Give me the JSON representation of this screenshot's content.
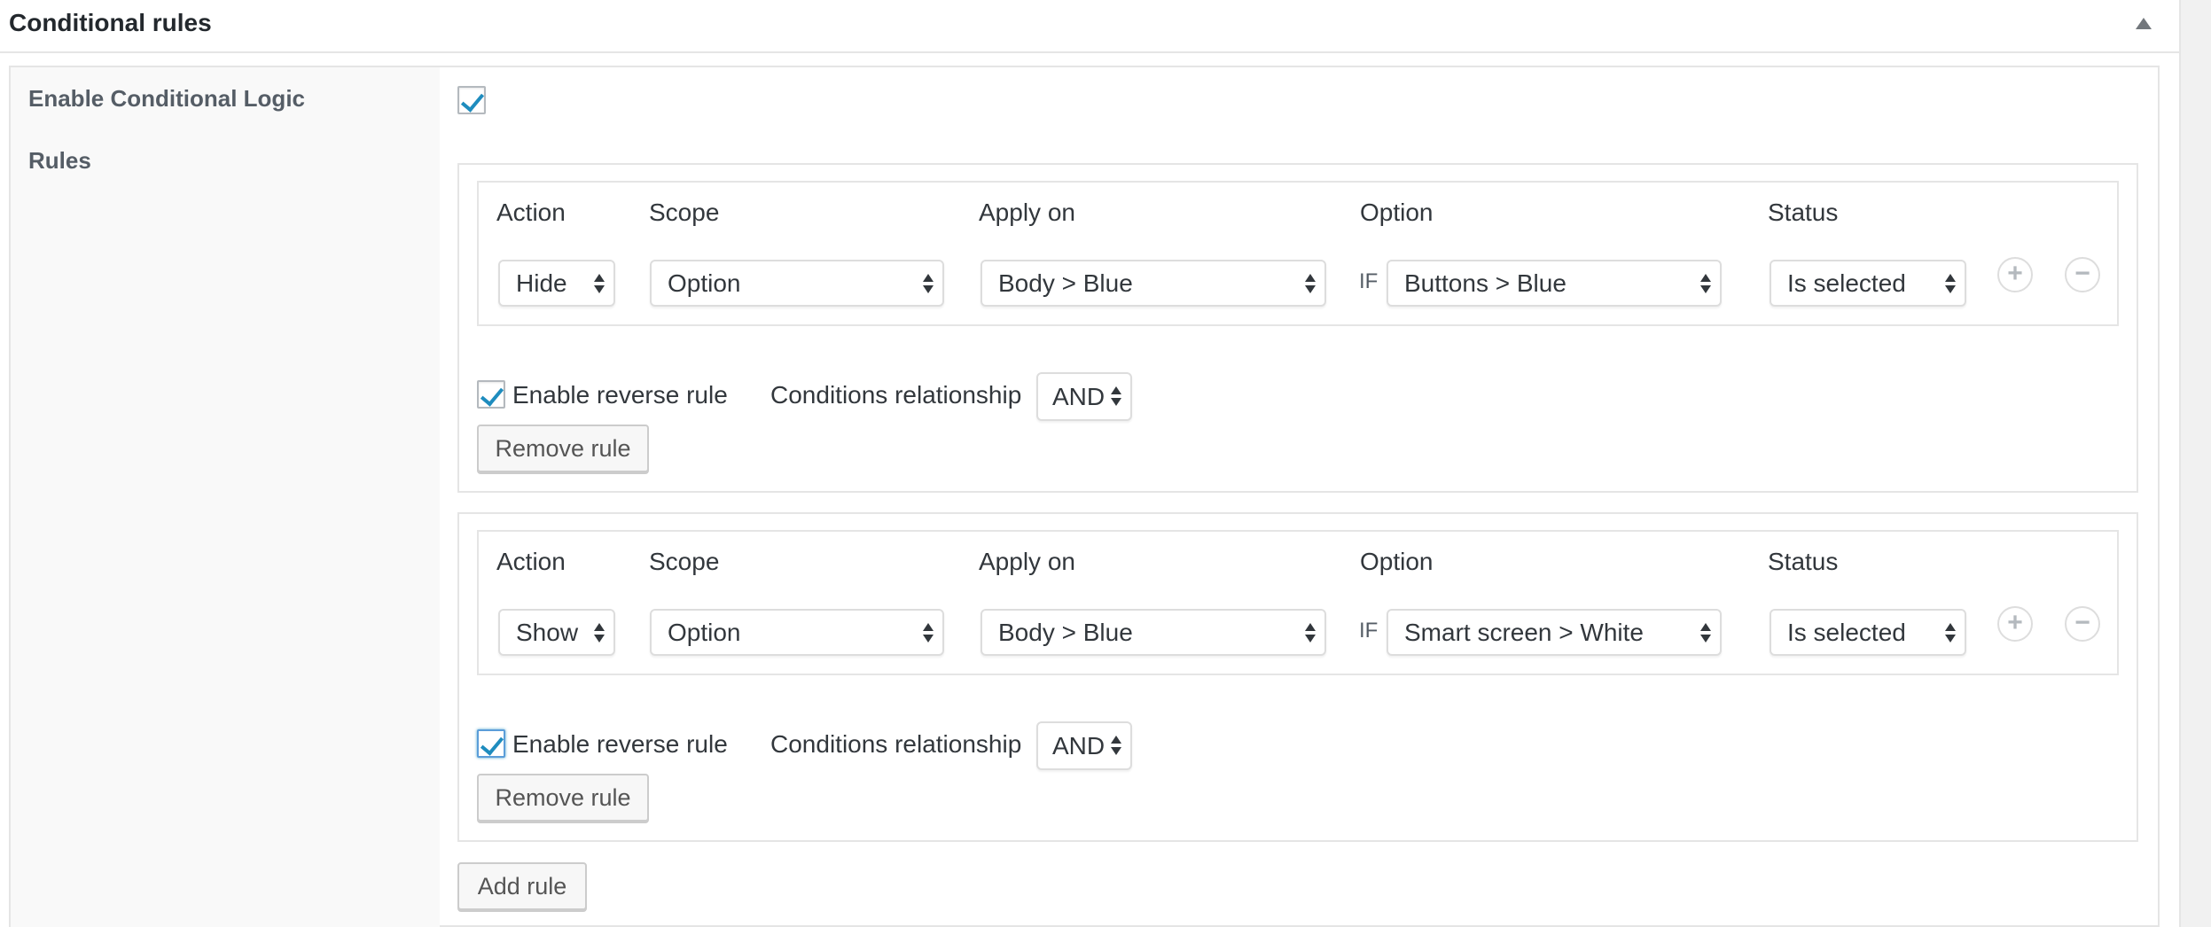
{
  "metabox": {
    "title": "Conditional rules"
  },
  "fields": {
    "enable_label": "Enable Conditional Logic",
    "enable_checked": true,
    "rules_label": "Rules"
  },
  "columns": {
    "action": "Action",
    "scope": "Scope",
    "apply_on": "Apply on",
    "option": "Option",
    "status": "Status",
    "if_label": "IF"
  },
  "rules": [
    {
      "action": "Hide",
      "scope": "Option",
      "apply_on": "Body > Blue",
      "option": "Buttons > Blue",
      "status": "Is selected",
      "reverse_label": "Enable reverse rule",
      "reverse_checked": true,
      "relationship_label": "Conditions relationship",
      "relationship": "AND",
      "remove_label": "Remove rule",
      "add_icon": "+",
      "remove_icon": "−"
    },
    {
      "action": "Show",
      "scope": "Option",
      "apply_on": "Body > Blue",
      "option": "Smart screen > White",
      "status": "Is selected",
      "reverse_label": "Enable reverse rule",
      "reverse_checked": true,
      "relationship_label": "Conditions relationship",
      "relationship": "AND",
      "remove_label": "Remove rule",
      "add_icon": "+",
      "remove_icon": "−"
    }
  ],
  "add_rule_label": "Add rule",
  "colors": {
    "accent": "#1e8cbe",
    "border": "#e5e5e5",
    "label_bg": "#f9f9f9"
  }
}
